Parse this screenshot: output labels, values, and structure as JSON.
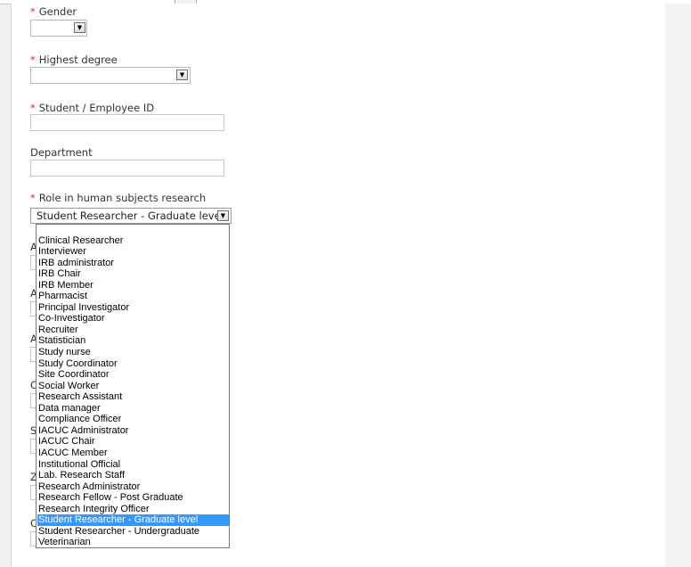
{
  "form": {
    "gender": {
      "label": "Gender",
      "required_marker": "*",
      "value": ""
    },
    "highest_degree": {
      "label": "Highest degree",
      "required_marker": "*",
      "value": ""
    },
    "student_employee_id": {
      "label": "Student / Employee ID",
      "required_marker": "*",
      "value": ""
    },
    "department": {
      "label": "Department",
      "value": ""
    },
    "role": {
      "label": "Role in human subjects research",
      "required_marker": "*",
      "value": "Student Researcher - Graduate level",
      "options": [
        "Clinical Researcher",
        "Interviewer",
        "IRB administrator",
        "IRB Chair",
        "IRB Member",
        "Pharmacist",
        "Principal Investigator",
        "Co-Investigator",
        "Recruiter",
        "Statistician",
        "Study nurse",
        "Study Coordinator",
        "Site Coordinator",
        "Social Worker",
        "Research Assistant",
        "Data manager",
        "Compliance Officer",
        "IACUC Administrator",
        "IACUC Chair",
        "IACUC Member",
        "Institutional Official",
        "Lab. Research Staff",
        "Research Administrator",
        "Research Fellow - Post Graduate",
        "Research Integrity Officer",
        "Student Researcher - Graduate level",
        "Student Researcher - Undergraduate",
        "Veterinarian"
      ],
      "selected_index": 25
    },
    "hidden_field_initials": [
      "A",
      "A",
      "A",
      "C",
      "S",
      "Z",
      "C"
    ]
  },
  "colors": {
    "required": "#d03030",
    "selection": "#3399ff"
  },
  "icons": {
    "dropdown_arrow": "chevron-down-icon"
  }
}
